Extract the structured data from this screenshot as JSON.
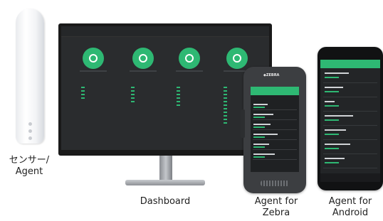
{
  "captions": {
    "sensor": "センサー/\nAgent",
    "dashboard": "Dashboard",
    "zebra": "Agent for\nZebra",
    "android": "Agent for\nAndroid"
  },
  "colors": {
    "accent": "#2eb873",
    "screen_bg": "#2a2c2e"
  },
  "devices": [
    "sensor",
    "monitor",
    "zebra-handheld",
    "android-phone"
  ]
}
